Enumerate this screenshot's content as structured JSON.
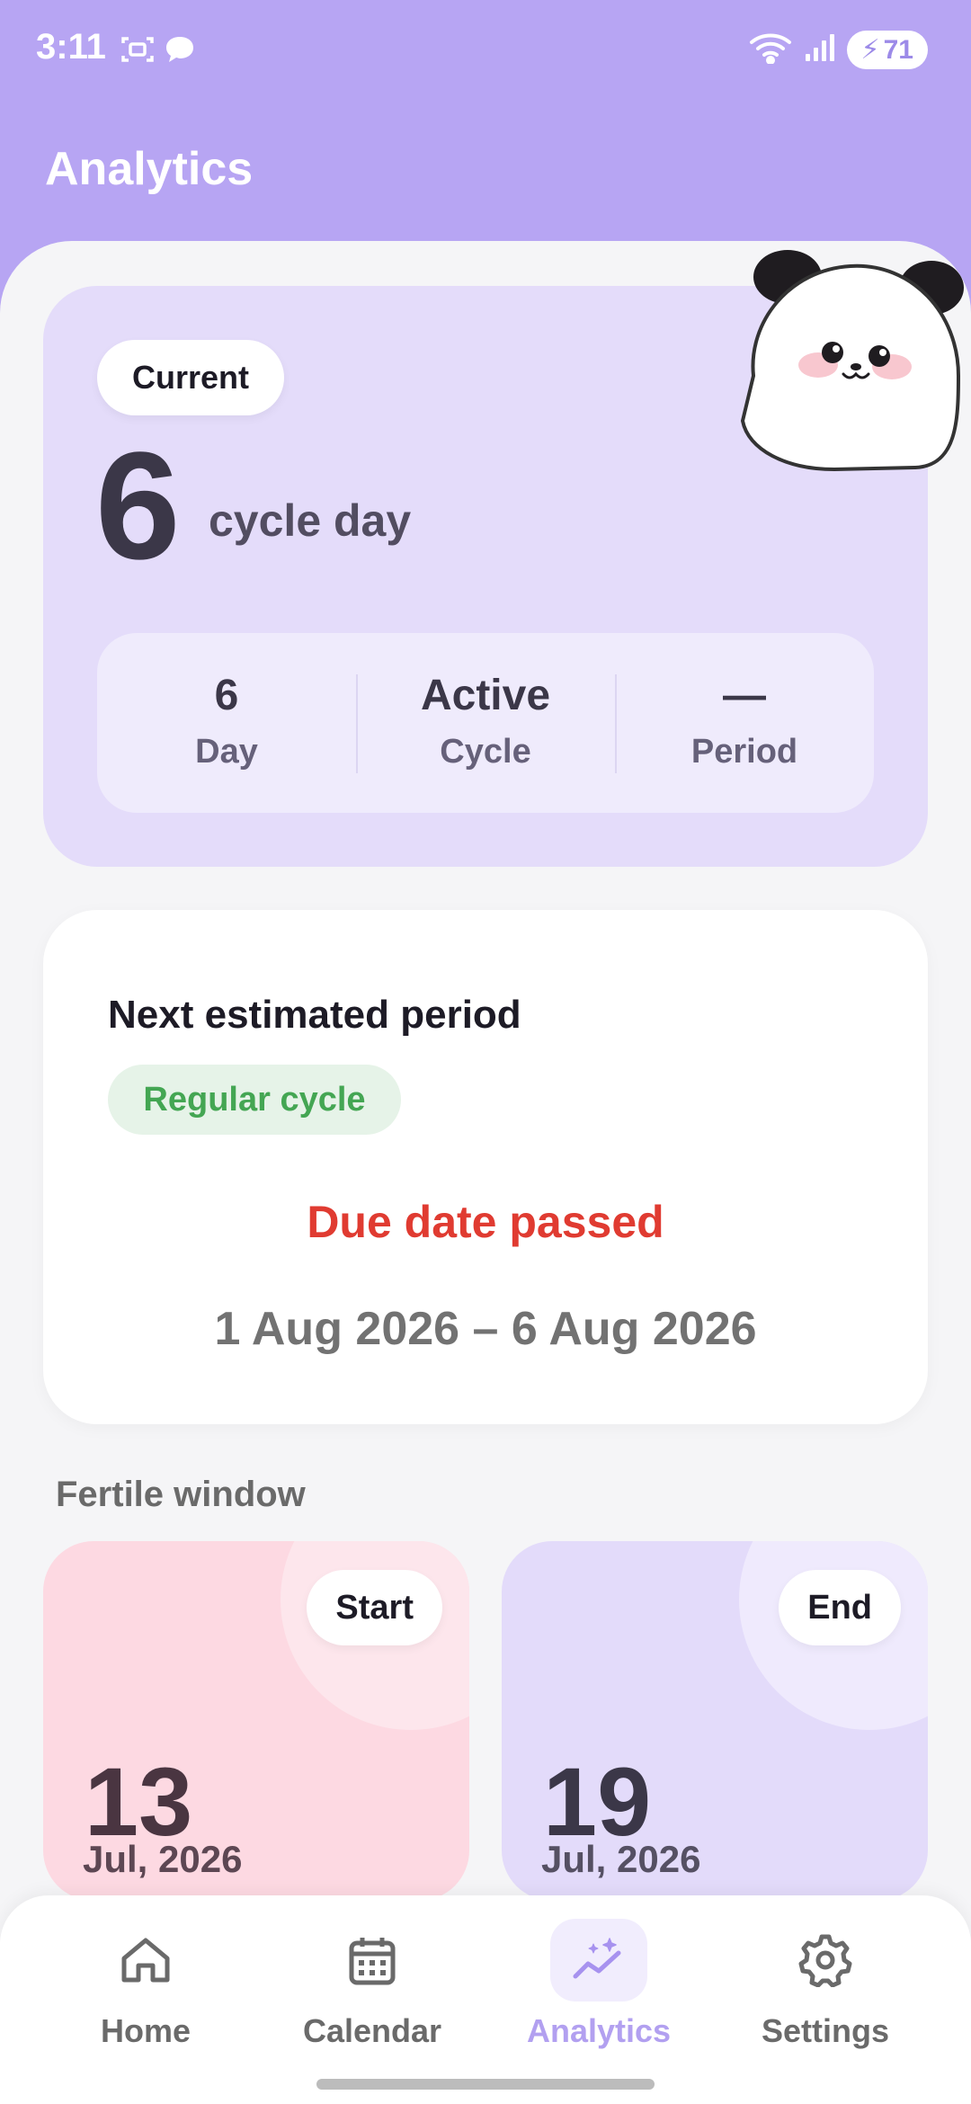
{
  "status_bar": {
    "time": "3:11",
    "battery": "71"
  },
  "header": {
    "title": "Analytics"
  },
  "current": {
    "badge": "Current",
    "day_number": "6",
    "day_label": "cycle day",
    "stats": [
      {
        "value": "6",
        "label": "Day"
      },
      {
        "value": "Active",
        "label": "Cycle"
      },
      {
        "value": "—",
        "label": "Period"
      }
    ]
  },
  "next_period": {
    "title": "Next estimated period",
    "badge": "Regular cycle",
    "status": "Due date passed",
    "range": "1 Aug 2026 – 6 Aug 2026"
  },
  "fertile_window": {
    "label": "Fertile window",
    "start": {
      "badge": "Start",
      "day": "13",
      "month_year": "Jul, 2026"
    },
    "end": {
      "badge": "End",
      "day": "19",
      "month_year": "Jul, 2026"
    }
  },
  "nav": {
    "items": [
      {
        "label": "Home",
        "icon": "home-icon"
      },
      {
        "label": "Calendar",
        "icon": "calendar-icon"
      },
      {
        "label": "Analytics",
        "icon": "analytics-icon",
        "active": true
      },
      {
        "label": "Settings",
        "icon": "gear-icon"
      }
    ]
  },
  "colors": {
    "accent": "#b7a5f3",
    "danger": "#e03b31",
    "success": "#44a653"
  }
}
